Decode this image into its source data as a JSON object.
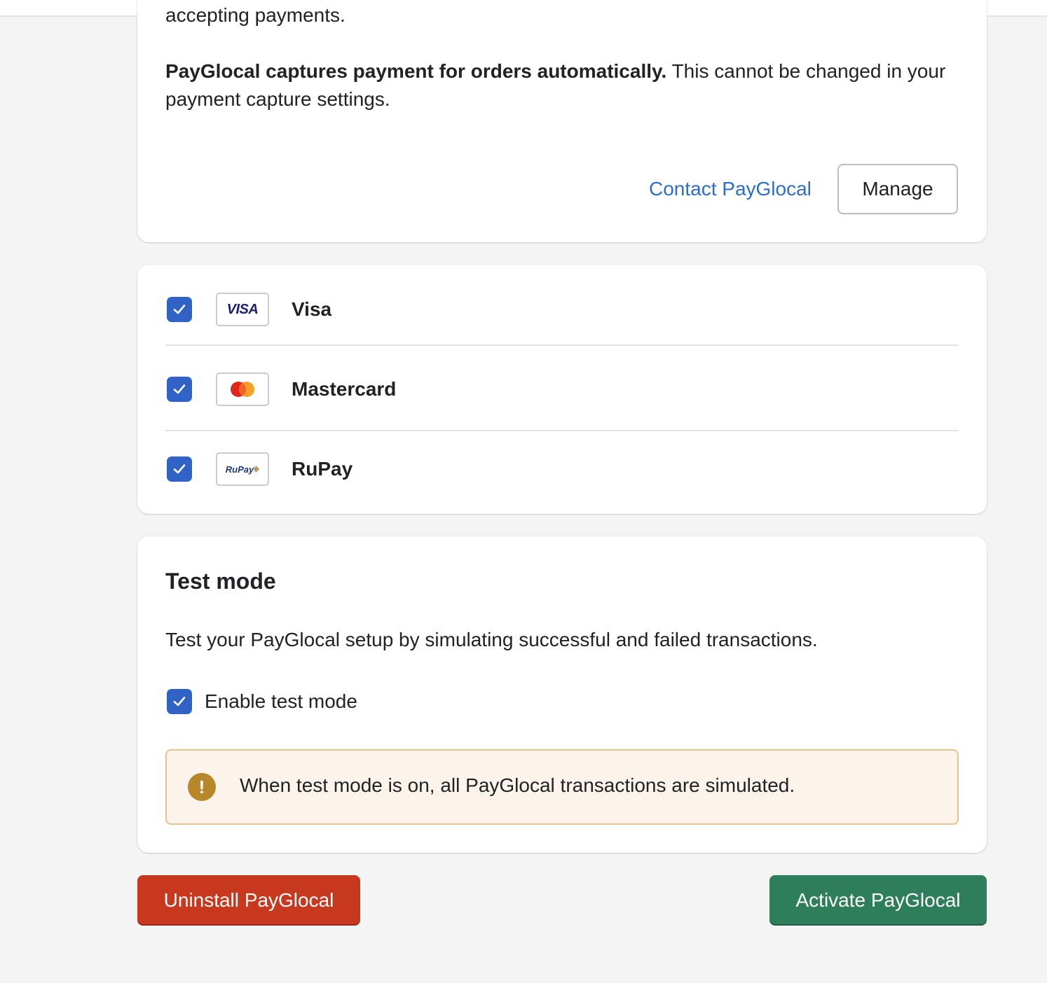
{
  "capture_card": {
    "clipped_text": "accepting payments.",
    "capture_bold": "PayGlocal captures payment for orders automatically.",
    "capture_rest": " This cannot be changed in your payment capture settings.",
    "contact_label": "Contact PayGlocal",
    "manage_label": "Manage"
  },
  "card_brands": [
    {
      "label": "Visa",
      "logo_text": "VISA",
      "checked": true
    },
    {
      "label": "Mastercard",
      "checked": true
    },
    {
      "label": "RuPay",
      "logo_text": "RuPay",
      "checked": true
    }
  ],
  "test_mode": {
    "title": "Test mode",
    "description": "Test your PayGlocal setup by simulating successful and failed transactions.",
    "enable_label": "Enable test mode",
    "enabled": true,
    "warning_icon": "!",
    "warning_text": "When test mode is on, all PayGlocal transactions are simulated."
  },
  "actions": {
    "uninstall_label": "Uninstall PayGlocal",
    "activate_label": "Activate PayGlocal"
  },
  "colors": {
    "accent": "#3162c5",
    "link": "#2c6ecb",
    "critical": "#c8381f",
    "primary": "#2e7d5b",
    "warning_bg": "#fcf3ea",
    "warning_border": "#e1c48f",
    "warning_icon": "#b8872a"
  }
}
